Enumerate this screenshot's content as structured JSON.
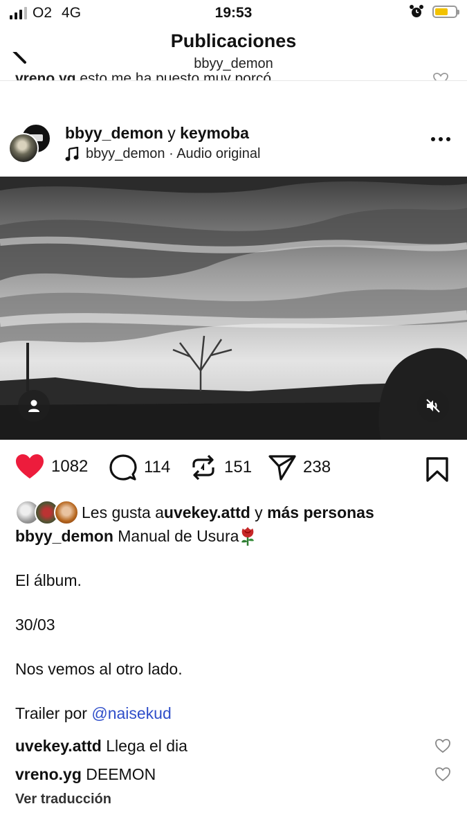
{
  "status_bar": {
    "carrier": "O2",
    "network": "4G",
    "time": "19:53",
    "battery_color": "#f2c200",
    "icons": [
      "signal-bars-icon",
      "alarm-clock-icon",
      "battery-icon"
    ]
  },
  "header": {
    "title": "Publicaciones",
    "subtitle": "bbyy_demon",
    "prev_comment_user": "vreno.yg",
    "prev_comment_text": " esto me ha puesto muy porcó"
  },
  "post": {
    "author_1": "bbyy_demon",
    "conjunction": " y ",
    "author_2": "keymoba",
    "audio_user": "bbyy_demon",
    "audio_sep": " · ",
    "audio_label": "Audio original"
  },
  "actions": {
    "likes": "1082",
    "comments": "114",
    "reposts": "151",
    "shares": "238",
    "like_color": "#ed1c3c",
    "liked": true
  },
  "likes_line": {
    "prefix": "Les gusta a ",
    "user": "uvekey.attd",
    "middle": " y ",
    "others": "más personas"
  },
  "caption": {
    "user": "bbyy_demon",
    "line1": " Manual de Usura",
    "emoji": "rose",
    "line2": "El álbum.",
    "line3": "30/03",
    "line4": "Nos vemos al otro lado.",
    "line5_prefix": "Trailer por ",
    "mention": "@naisekud"
  },
  "comments": [
    {
      "user": "uvekey.attd",
      "text": " Llega el dia"
    },
    {
      "user": "vreno.yg",
      "text": " DEEMON"
    }
  ],
  "see_translation": "Ver traducción",
  "colors": {
    "mention": "#2f4ec9"
  }
}
